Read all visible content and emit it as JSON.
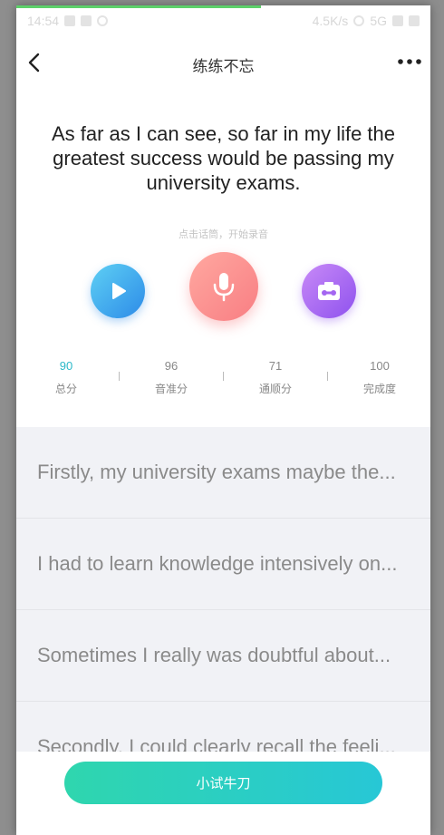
{
  "status_bar": {
    "time": "14:54",
    "network_speed": "4.5K/s",
    "signal": "5G"
  },
  "nav": {
    "title": "练练不忘"
  },
  "practice": {
    "sentence": "As far as I can see, so far in my life the greatest success would be passing my university exams.",
    "record_hint": "点击话筒，开始录音"
  },
  "scores": [
    {
      "value": "90",
      "label": "总分"
    },
    {
      "value": "96",
      "label": "音准分"
    },
    {
      "value": "71",
      "label": "通顺分"
    },
    {
      "value": "100",
      "label": "完成度"
    }
  ],
  "sentence_list": [
    {
      "text": "Firstly, my university exams maybe the..."
    },
    {
      "text": "I had to learn knowledge intensively on..."
    },
    {
      "text": "Sometimes I really was doubtful about..."
    },
    {
      "text": "Secondly, I could clearly recall the feeli..."
    }
  ],
  "bottom": {
    "button_label": "小试牛刀"
  },
  "colors": {
    "accent": "#2bb9c9",
    "play": "#2d8be8",
    "mic": "#f87e83",
    "tape": "#8f52ee",
    "primary_button": "#27c7d6"
  },
  "icons": {
    "back": "chevron-left-icon",
    "more": "more-dots-icon",
    "play": "play-icon",
    "mic": "microphone-icon",
    "tape": "cassette-icon"
  }
}
